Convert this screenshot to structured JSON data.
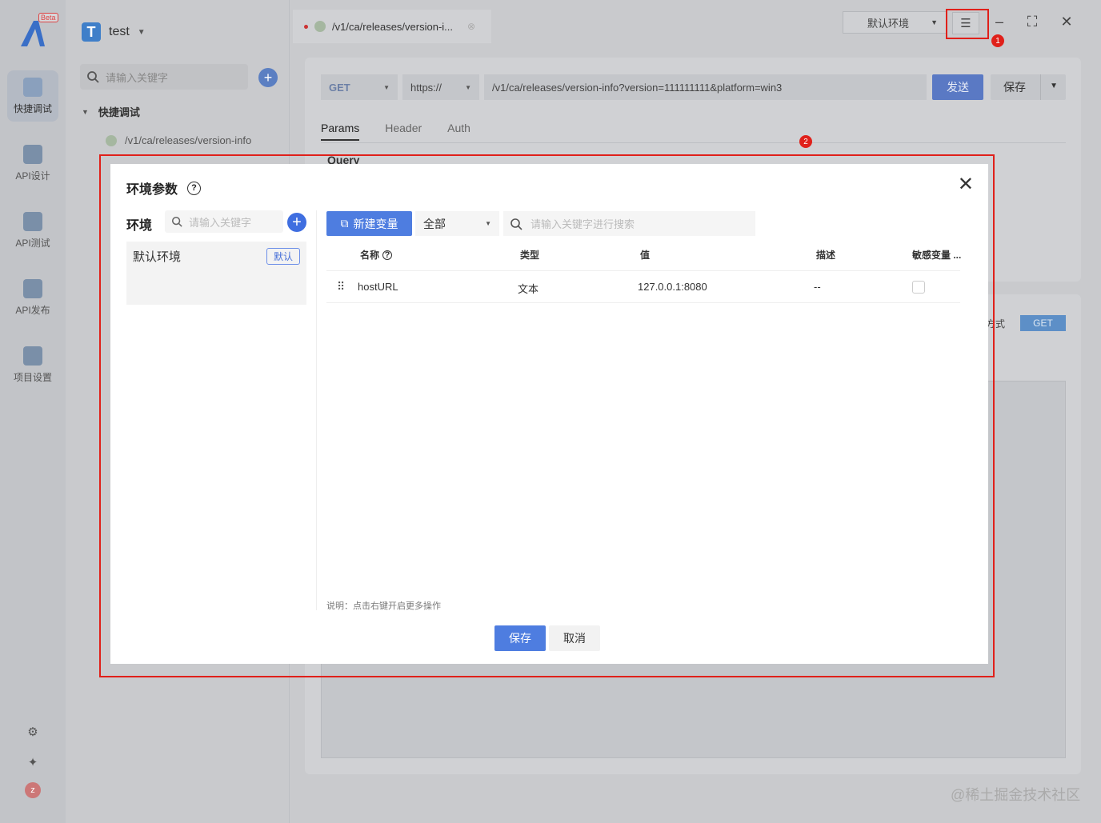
{
  "app": {
    "beta_badge": "Beta",
    "project_name": "test",
    "rail": [
      {
        "label": "快捷调试",
        "active": true
      },
      {
        "label": "API设计"
      },
      {
        "label": "API测试"
      },
      {
        "label": "API发布"
      },
      {
        "label": "项目设置"
      }
    ],
    "avatar_letter": "z"
  },
  "sidebar": {
    "search_placeholder": "请输入关键字",
    "tree_root": "快捷调试",
    "tree_leaf": "/v1/ca/releases/version-info"
  },
  "tabs": [
    {
      "label": "/v1/ca/releases/version-i..."
    }
  ],
  "topbar": {
    "env_select": "默认环境",
    "badge1": "1",
    "badge2": "2"
  },
  "request": {
    "method": "GET",
    "protocol": "https://",
    "url": "/v1/ca/releases/version-info?version=111111111&platform=win3",
    "send_label": "发送",
    "save_label": "保存",
    "tabs": [
      "Params",
      "Header",
      "Auth"
    ],
    "query_label": "Query",
    "method_label": "方式",
    "method_tag": "GET"
  },
  "watermark": "@稀土掘金技术社区",
  "modal": {
    "title": "环境参数",
    "env_label": "环境",
    "env_search_placeholder": "请输入关键字",
    "environments": [
      {
        "name": "默认环境",
        "tag": "默认"
      }
    ],
    "new_var_label": "新建变量",
    "type_filter": "全部",
    "var_search_placeholder": "请输入关键字进行搜索",
    "columns": [
      "名称",
      "类型",
      "值",
      "描述",
      "敏感变量 ..."
    ],
    "rows": [
      {
        "name": "hostURL",
        "type": "文本",
        "value": "127.0.0.1:8080",
        "desc": "--",
        "sensitive": false
      }
    ],
    "note": "说明：点击右键开启更多操作",
    "save_label": "保存",
    "cancel_label": "取消"
  },
  "colors": {
    "primary": "#4e7de0",
    "highlight": "#e0201a"
  }
}
